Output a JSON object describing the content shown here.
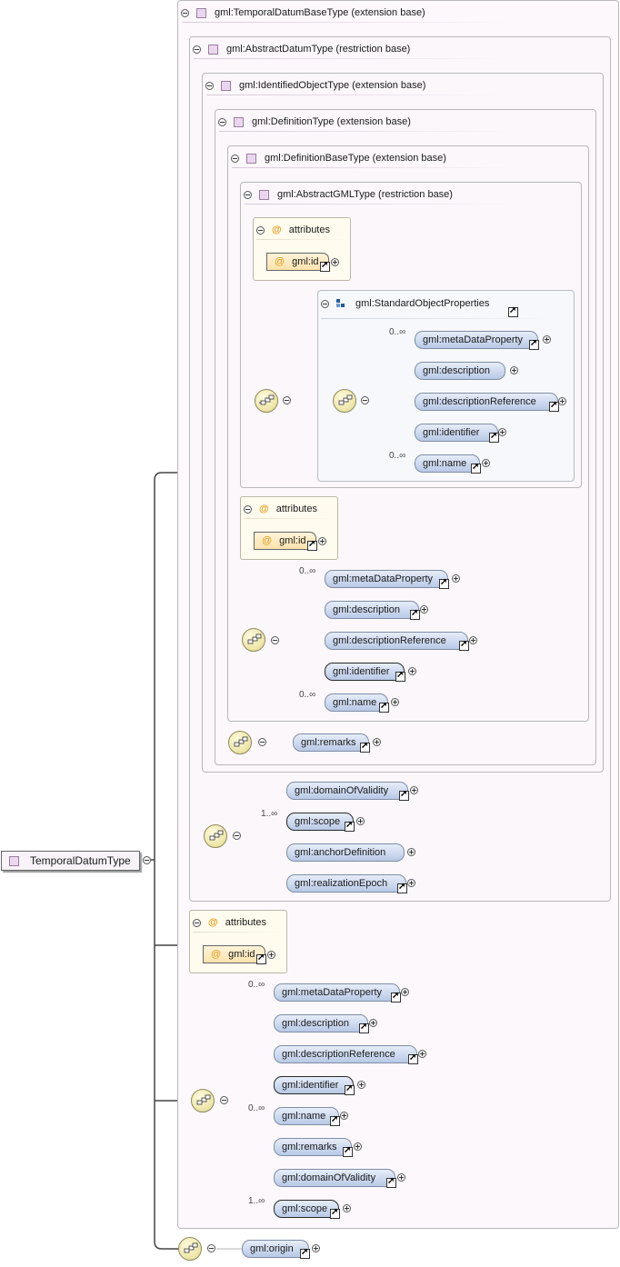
{
  "root": {
    "label": "TemporalDatumType"
  },
  "bases": {
    "temporalDatumBase": "gml:TemporalDatumBaseType (extension base)",
    "abstractDatum": "gml:AbstractDatumType (restriction base)",
    "identifiedObject": "gml:IdentifiedObjectType (extension base)",
    "definition": "gml:DefinitionType (extension base)",
    "definitionBase": "gml:DefinitionBaseType (extension base)",
    "abstractGML": "gml:AbstractGMLType (restriction base)"
  },
  "attributes": {
    "title": "attributes",
    "id": "gml:id",
    "icon": "at-icon"
  },
  "group": {
    "label": "gml:StandardObjectProperties"
  },
  "group_elements": [
    {
      "label": "gml:metaDataProperty",
      "card": "0..∞"
    },
    {
      "label": "gml:description",
      "card": ""
    },
    {
      "label": "gml:descriptionReference",
      "card": ""
    },
    {
      "label": "gml:identifier",
      "card": ""
    },
    {
      "label": "gml:name",
      "card": "0..∞"
    }
  ],
  "defbase_elements": [
    {
      "label": "gml:metaDataProperty",
      "card": "0..∞"
    },
    {
      "label": "gml:description",
      "card": ""
    },
    {
      "label": "gml:descriptionReference",
      "card": ""
    },
    {
      "label": "gml:identifier",
      "card": ""
    },
    {
      "label": "gml:name",
      "card": "0..∞"
    }
  ],
  "remarks": {
    "label": "gml:remarks"
  },
  "datum_elements": [
    {
      "label": "gml:domainOfValidity",
      "card": ""
    },
    {
      "label": "gml:scope",
      "card": "1..∞"
    },
    {
      "label": "gml:anchorDefinition",
      "card": ""
    },
    {
      "label": "gml:realizationEpoch",
      "card": ""
    }
  ],
  "restricted_elements": [
    {
      "label": "gml:metaDataProperty",
      "card": "0..∞"
    },
    {
      "label": "gml:description",
      "card": ""
    },
    {
      "label": "gml:descriptionReference",
      "card": ""
    },
    {
      "label": "gml:identifier",
      "card": ""
    },
    {
      "label": "gml:name",
      "card": "0..∞"
    },
    {
      "label": "gml:remarks",
      "card": ""
    },
    {
      "label": "gml:domainOfValidity",
      "card": ""
    },
    {
      "label": "gml:scope",
      "card": "1..∞"
    }
  ],
  "origin": {
    "label": "gml:origin"
  },
  "colors": {
    "element_fill": "#c9d7ef",
    "attribute_fill": "#fde9be",
    "type_square": "#ead6ee",
    "sequence": "#ece4a4"
  }
}
